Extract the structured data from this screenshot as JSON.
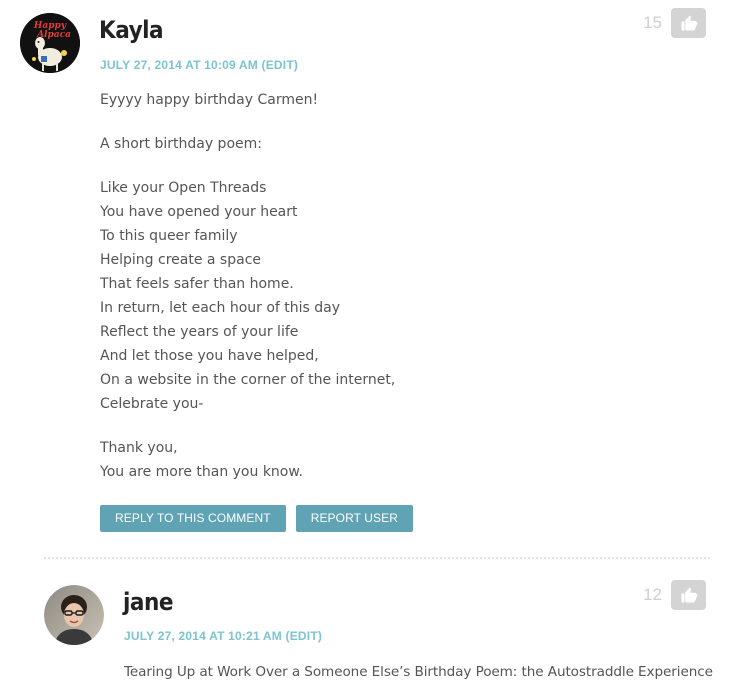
{
  "comments": [
    {
      "author": "Kayla",
      "date": "JULY 27, 2014 AT 10:09 AM",
      "edit_label": "(EDIT)",
      "vote_count": "15",
      "avatar_icon": "happy-alpaca-avatar",
      "avatar_text": "Happy Alpaca",
      "paragraphs": {
        "p1": "Eyyyy happy birthday Carmen!",
        "p2": "A short birthday poem:",
        "poem": [
          "Like your Open Threads",
          "You have opened your heart",
          "To this queer family",
          "Helping create a space",
          "That feels safer than home.",
          "In return, let each hour of this day",
          "Reflect the years of your life",
          "And let those you have helped,",
          "On a website in the corner of the internet,",
          "Celebrate you-"
        ],
        "closing": [
          "Thank you,",
          "You are more than you know."
        ]
      },
      "reply_label": "REPLY TO THIS COMMENT",
      "report_label": "REPORT USER"
    },
    {
      "author": "jane",
      "date": "JULY 27, 2014 AT 10:21 AM",
      "edit_label": "(EDIT)",
      "vote_count": "12",
      "avatar_icon": "user-photo-avatar",
      "text": "Tearing Up at Work Over a Someone Else’s Birthday Poem: the Autostraddle Experience"
    }
  ],
  "colors": {
    "accent": "#7cc4cf",
    "button": "#60a3b5",
    "like_button": "#d4d4d4",
    "vote_count": "#cfcfcf",
    "author": "#222222",
    "body_text": "#555555"
  },
  "icons": {
    "like": "thumbs-up-icon"
  }
}
